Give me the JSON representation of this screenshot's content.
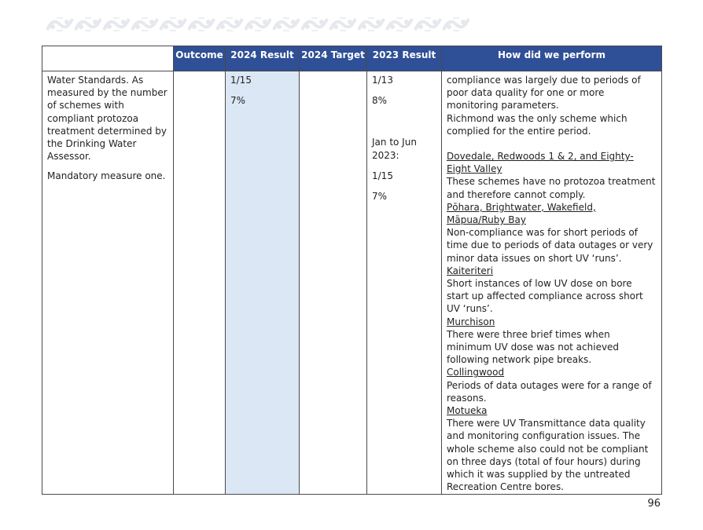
{
  "table": {
    "headers": {
      "outcome": "Outcome",
      "result_2024": "2024 Result",
      "target_2024": "2024 Target",
      "result_2023": "2023 Result",
      "how_performed": "How did we perform"
    },
    "measure": {
      "text": "Water Standards. As measured by the number of schemes with compliant protozoa treatment determined by the Drinking Water Assessor.",
      "mandatory": "Mandatory measure one."
    },
    "result_2024": {
      "count": "1/15",
      "percent": "7%"
    },
    "target_2024": "",
    "result_2023": {
      "count": "1/13",
      "percent": "8%",
      "period_label": "Jan to Jun 2023:",
      "period_count": "1/15",
      "period_percent": "7%"
    },
    "performance": {
      "intro": "compliance was largely due to periods of poor data quality for one or more monitoring parameters.",
      "richmond": "Richmond was the only scheme which complied for the entire period.",
      "sections": [
        {
          "heading": "Dovedale, Redwoods 1 & 2, and Eighty-Eight Valley",
          "text": "These schemes have no protozoa treatment and therefore cannot comply."
        },
        {
          "heading": "Pōhara, Brightwater, Wakefield, Māpua/Ruby Bay",
          "text": "Non-compliance was for short periods of time due to periods of data outages or very minor data issues on short UV ‘runs’."
        },
        {
          "heading": "Kaiteriteri",
          "text": "Short instances of low UV dose on bore start up affected compliance across short UV ‘runs’."
        },
        {
          "heading": "Murchison",
          "text": "There were three brief times when minimum UV dose was not achieved following network pipe breaks."
        },
        {
          "heading": "Collingwood",
          "text": "Periods of data outages were for a range of reasons."
        },
        {
          "heading": "Motueka",
          "text": "There were UV Transmittance data quality and monitoring configuration issues. The whole scheme also could not be compliant on three days (total of four hours) during which it was supplied by the untreated Recreation Centre bores."
        }
      ]
    }
  },
  "page_number": "96",
  "colors": {
    "header_bg": "#2f4f96",
    "shaded_column": "#dbe7f4",
    "banner_pattern": "#e6e8ee"
  }
}
